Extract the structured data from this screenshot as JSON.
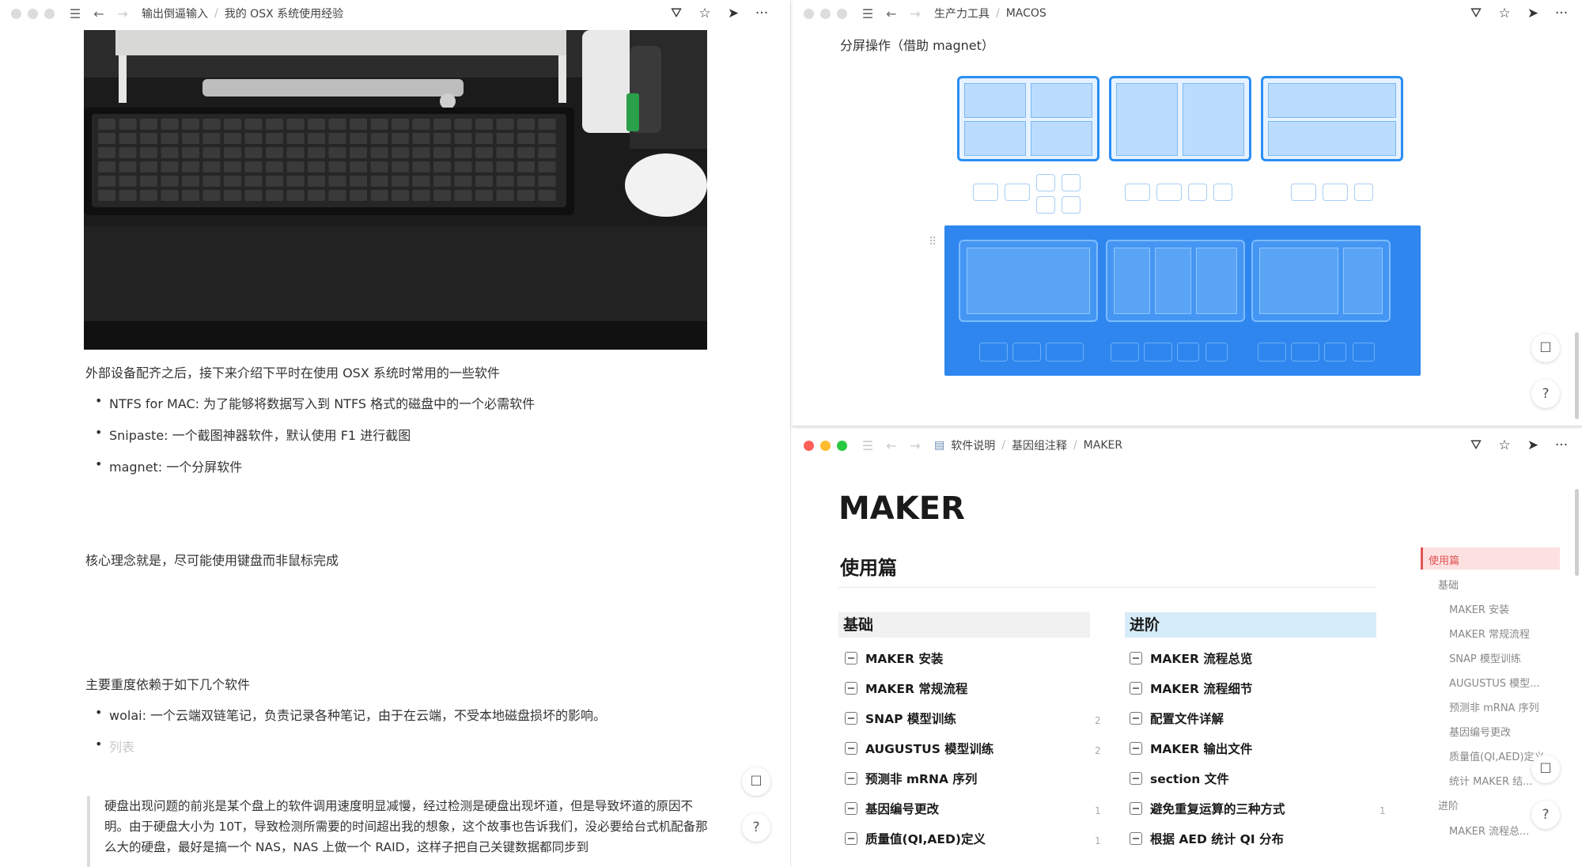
{
  "left_window": {
    "breadcrumb": [
      "输出倒逼输入",
      "我的 OSX 系统使用经验"
    ],
    "intro": "外部设备配齐之后，接下来介绍下平时在使用 OSX 系统时常用的一些软件",
    "software_list": [
      "NTFS for MAC: 为了能够将数据写入到 NTFS 格式的磁盘中的一个必需软件",
      "Snipaste: 一个截图神器软件，默认使用 F1 进行截图",
      "magnet: 一个分屏软件"
    ],
    "core_idea": "核心理念就是，尽可能使用键盘而非鼠标完成",
    "depend_intro": "主要重度依赖于如下几个软件",
    "depend_list": [
      "wolai: 一个云端双链笔记，负责记录各种笔记，由于在云端，不受本地磁盘损坏的影响。"
    ],
    "list_placeholder": "列表",
    "quote": "硬盘出现问题的前兆是某个盘上的软件调用速度明显减慢，经过检测是硬盘出现坏道，但是导致坏道的原因不明。由于硬盘大小为 10T，导致检测所需要的时间超出我的想象，这个故事也告诉我们，没必要给台式机配备那么大的硬盘，最好是搞一个 NAS，NAS 上做一个 RAID，这样子把自己关键数据都同步到"
  },
  "top_right_window": {
    "breadcrumb": [
      "生产力工具",
      "MACOS"
    ],
    "caption": "分屏操作（借助 magnet）"
  },
  "bottom_right_window": {
    "breadcrumb": [
      "软件说明",
      "基因组注释",
      "MAKER"
    ],
    "title": "MAKER",
    "section": "使用篇",
    "basic": {
      "heading": "基础",
      "items": [
        {
          "label": "MAKER 安装",
          "count": ""
        },
        {
          "label": "MAKER 常规流程",
          "count": ""
        },
        {
          "label": "SNAP 模型训练",
          "count": "2"
        },
        {
          "label": "AUGUSTUS 模型训练",
          "count": "2"
        },
        {
          "label": "预测非 mRNA 序列",
          "count": ""
        },
        {
          "label": "基因编号更改",
          "count": "1"
        },
        {
          "label": "质量值(QI,AED)定义",
          "count": "1"
        }
      ]
    },
    "advanced": {
      "heading": "进阶",
      "items": [
        {
          "label": "MAKER 流程总览",
          "count": ""
        },
        {
          "label": "MAKER 流程细节",
          "count": ""
        },
        {
          "label": "配置文件详解",
          "count": ""
        },
        {
          "label": "MAKER 输出文件",
          "count": ""
        },
        {
          "label": "section 文件",
          "count": ""
        },
        {
          "label": "避免重复运算的三种方式",
          "count": "1"
        },
        {
          "label": "根据 AED 统计 QI 分布",
          "count": ""
        }
      ]
    },
    "toc": [
      "使用篇",
      "基础",
      "MAKER 安装",
      "MAKER 常规流程",
      "SNAP 模型训练",
      "AUGUSTUS 模型...",
      "预测非 mRNA 序列",
      "基因编号更改",
      "质量值(QI,AED)定义",
      "统计 MAKER 结...",
      "进阶",
      "MAKER 流程总..."
    ]
  },
  "icons": {
    "menu": "☰",
    "back": "←",
    "forward": "→",
    "share": "⛛",
    "star": "☆",
    "send": "➤",
    "more": "···",
    "comment": "☐",
    "help": "?",
    "folder": "▤"
  },
  "colors": {
    "magnet_blue": "#2f86ef",
    "toc_active": "#fde1e1",
    "basic_header": "#f1f1f1",
    "advanced_header": "#d6ecf8"
  }
}
